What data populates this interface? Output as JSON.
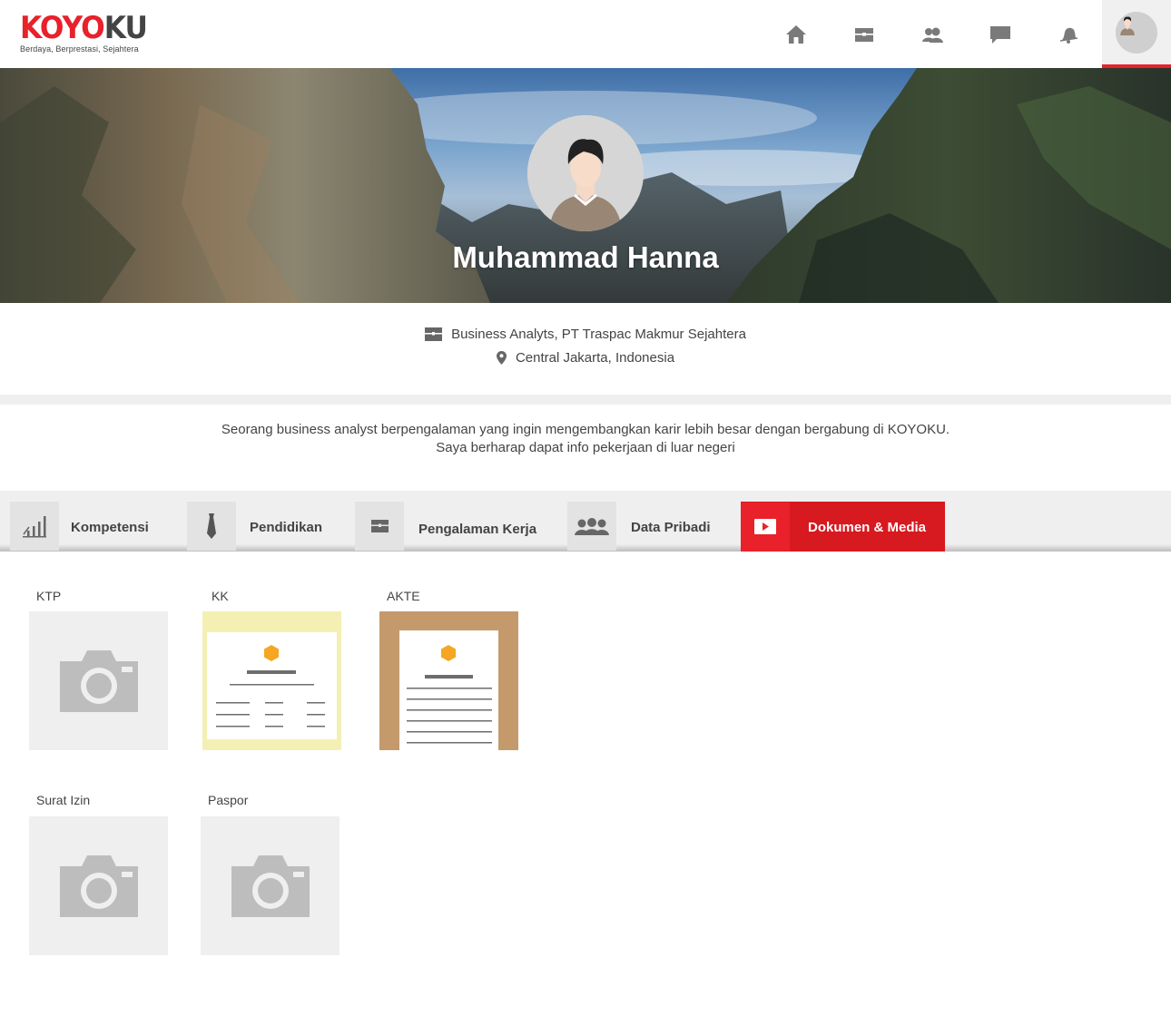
{
  "app": {
    "logo_part_a": "KOYO",
    "logo_part_b": "KU",
    "tagline": "Berdaya, Berprestasi, Sejahtera"
  },
  "nav": {
    "icons": [
      "home-icon",
      "briefcase-icon",
      "people-icon",
      "chat-icon",
      "bell-icon",
      "profile-avatar"
    ],
    "active": "profile"
  },
  "profile": {
    "name": "Muhammad Hanna",
    "job": "Business Analyts,  PT Traspac Makmur Sejahtera",
    "location": "Central Jakarta, Indonesia",
    "bio_line1": "Seorang business  analyst berpengalaman yang ingin mengembangkan karir lebih besar dengan bergabung di KOYOKU.",
    "bio_line2": "Saya berharap dapat info pekerjaan di luar negeri"
  },
  "tabs": [
    {
      "label": "Kompetensi",
      "icon": "bar-chart-icon"
    },
    {
      "label": "Pendidikan",
      "icon": "tie-icon"
    },
    {
      "label": "Pengalaman Kerja",
      "icon": "briefcase-icon"
    },
    {
      "label": "Data Pribadi",
      "icon": "group-icon"
    },
    {
      "label": "Dokumen & Media",
      "icon": "play-icon",
      "active": true
    }
  ],
  "documents": [
    {
      "label": "KTP",
      "thumb": "camera-placeholder"
    },
    {
      "label": "KK",
      "thumb": "yellow-certificate"
    },
    {
      "label": "AKTE",
      "thumb": "brown-certificate"
    },
    {
      "label": "Surat Izin",
      "thumb": "camera-placeholder"
    },
    {
      "label": "Paspor",
      "thumb": "camera-placeholder"
    }
  ],
  "colors": {
    "accent": "#e8212a",
    "text": "#444444",
    "panel": "#efefef"
  }
}
